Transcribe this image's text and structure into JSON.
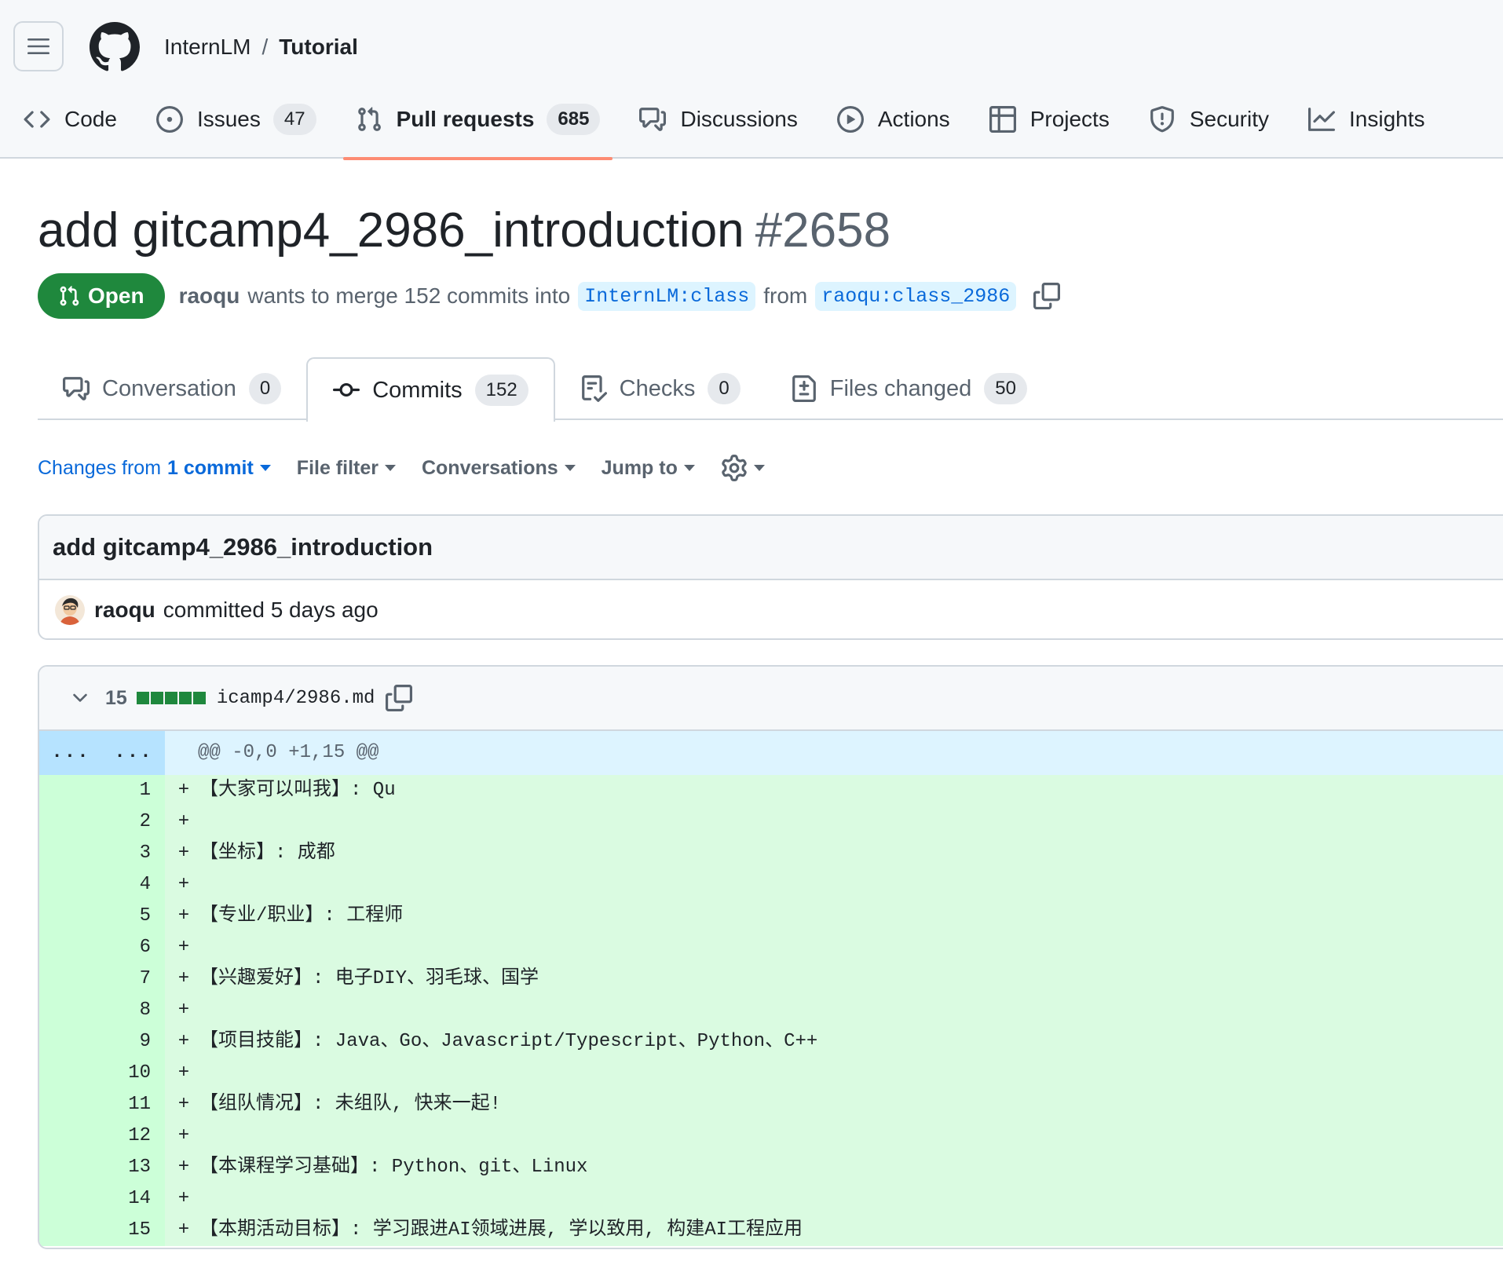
{
  "repo": {
    "owner": "InternLM",
    "separator": "/",
    "name": "Tutorial"
  },
  "nav": [
    {
      "label": "Code",
      "icon": "code-icon"
    },
    {
      "label": "Issues",
      "count": "47",
      "icon": "issue-icon"
    },
    {
      "label": "Pull requests",
      "count": "685",
      "icon": "pull-request-icon",
      "active": true
    },
    {
      "label": "Discussions",
      "icon": "discussions-icon"
    },
    {
      "label": "Actions",
      "icon": "play-icon"
    },
    {
      "label": "Projects",
      "icon": "table-icon"
    },
    {
      "label": "Security",
      "icon": "shield-icon"
    },
    {
      "label": "Insights",
      "icon": "graph-icon"
    }
  ],
  "pr": {
    "title": "add gitcamp4_2986_introduction",
    "number": "#2658",
    "state": "Open",
    "author": "raoqu",
    "merge_text": "wants to merge 152 commits into",
    "base_branch": "InternLM:class",
    "from_text": "from",
    "head_branch": "raoqu:class_2986"
  },
  "tabs": [
    {
      "label": "Conversation",
      "count": "0",
      "icon": "comment-icon"
    },
    {
      "label": "Commits",
      "count": "152",
      "icon": "commit-icon",
      "active": true
    },
    {
      "label": "Checks",
      "count": "0",
      "icon": "checklist-icon"
    },
    {
      "label": "Files changed",
      "count": "50",
      "icon": "file-diff-icon"
    }
  ],
  "filters": {
    "changes_prefix": "Changes from",
    "changes_bold": "1 commit",
    "file_filter": "File filter",
    "conversations": "Conversations",
    "jump_to": "Jump to"
  },
  "commit": {
    "title": "add gitcamp4_2986_introduction",
    "author": "raoqu",
    "meta": "committed 5 days ago"
  },
  "diff": {
    "changes": "15",
    "filename": "icamp4/2986.md",
    "hunk_old": "...",
    "hunk_new": "...",
    "hunk_header": "@@ -0,0 +1,15 @@",
    "lines": [
      {
        "n": "1",
        "sign": "+",
        "code": "【大家可以叫我】: Qu"
      },
      {
        "n": "2",
        "sign": "+",
        "code": ""
      },
      {
        "n": "3",
        "sign": "+",
        "code": "【坐标】: 成都"
      },
      {
        "n": "4",
        "sign": "+",
        "code": ""
      },
      {
        "n": "5",
        "sign": "+",
        "code": "【专业/职业】: 工程师"
      },
      {
        "n": "6",
        "sign": "+",
        "code": ""
      },
      {
        "n": "7",
        "sign": "+",
        "code": "【兴趣爱好】: 电子DIY、羽毛球、国学"
      },
      {
        "n": "8",
        "sign": "+",
        "code": ""
      },
      {
        "n": "9",
        "sign": "+",
        "code": "【项目技能】: Java、Go、Javascript/Typescript、Python、C++"
      },
      {
        "n": "10",
        "sign": "+",
        "code": ""
      },
      {
        "n": "11",
        "sign": "+",
        "code": "【组队情况】: 未组队, 快来一起!"
      },
      {
        "n": "12",
        "sign": "+",
        "code": ""
      },
      {
        "n": "13",
        "sign": "+",
        "code": "【本课程学习基础】: Python、git、Linux"
      },
      {
        "n": "14",
        "sign": "+",
        "code": ""
      },
      {
        "n": "15",
        "sign": "+",
        "code": "【本期活动目标】: 学习跟进AI领域进展, 学以致用, 构建AI工程应用"
      }
    ]
  },
  "colors": {
    "accent_open": "#1f883d",
    "link": "#0969da",
    "active_underline": "#fd8c73",
    "diff_add": "#dafbe1"
  }
}
